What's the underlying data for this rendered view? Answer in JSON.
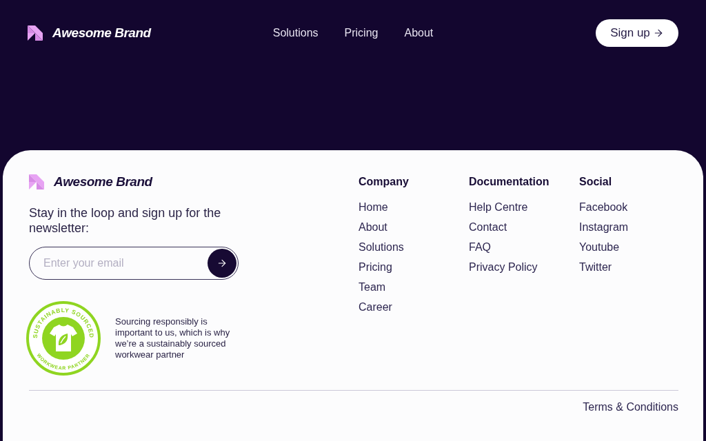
{
  "header": {
    "brand": "Awesome Brand",
    "nav": [
      "Solutions",
      "Pricing",
      "About"
    ],
    "signup_button": "Sign up"
  },
  "footer": {
    "brand": "Awesome Brand",
    "newsletter": {
      "text": "Stay in the loop and sign up for the newsletter:",
      "placeholder": "Enter your email"
    },
    "badge": {
      "ring_top": "SUSTAINABLY SOURCED",
      "ring_bottom": "WORKWEAR PARTNER",
      "caption": "Sourcing responsibly is important to us, which is why we’re a sustainably sourced workwear partner"
    },
    "columns": [
      {
        "heading": "Company",
        "links": [
          "Home",
          "About",
          "Solutions",
          "Pricing",
          "Team",
          "Career"
        ]
      },
      {
        "heading": "Documentation",
        "links": [
          "Help Centre",
          "Contact",
          "FAQ",
          "Privacy Policy"
        ]
      },
      {
        "heading": "Social",
        "links": [
          "Facebook",
          "Instagram",
          "Youtube",
          "Twitter"
        ]
      }
    ],
    "terms": "Terms & Conditions"
  }
}
